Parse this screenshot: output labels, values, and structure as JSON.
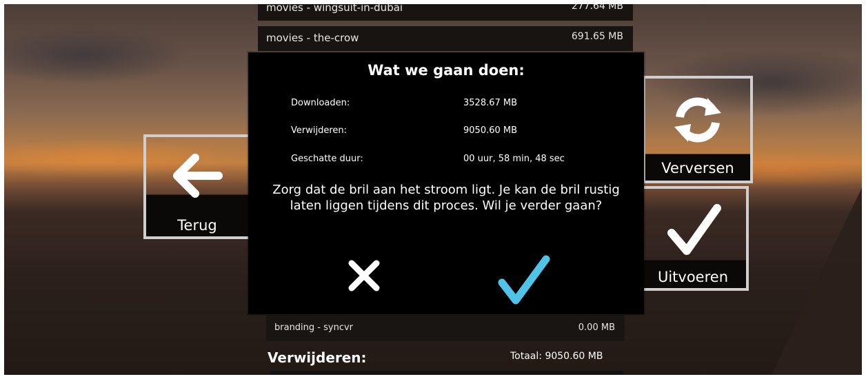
{
  "list": {
    "items": [
      {
        "name": "movies - wingsuit-in-dubai",
        "size": "277.64 MB"
      },
      {
        "name": "movies - the-crow",
        "size": "691.65 MB"
      }
    ],
    "branding_item": {
      "name": "branding - syncvr",
      "size": "0.00 MB"
    },
    "remove_section": {
      "label": "Verwijderen:",
      "total": "Totaal: 9050.60 MB"
    }
  },
  "buttons": {
    "back": {
      "label": "Terug",
      "icon": "arrow-left-icon"
    },
    "refresh": {
      "label": "Verversen",
      "icon": "refresh-icon"
    },
    "execute": {
      "label": "Uitvoeren",
      "icon": "checkmark-icon"
    }
  },
  "dialog": {
    "title": "Wat we gaan doen:",
    "rows": [
      {
        "label": "Downloaden:",
        "value": "3528.67 MB"
      },
      {
        "label": "Verwijderen:",
        "value": "9050.60 MB"
      },
      {
        "label": "Geschatte duur:",
        "value": "00 uur, 58 min, 48 sec"
      }
    ],
    "message": "Zorg dat de bril aan het stroom ligt. Je kan de bril rustig laten liggen tijdens dit proces. Wil je verder gaan?",
    "cancel_icon": "close-icon",
    "confirm_icon": "checkmark-icon",
    "confirm_color": "#4fc3e8"
  }
}
